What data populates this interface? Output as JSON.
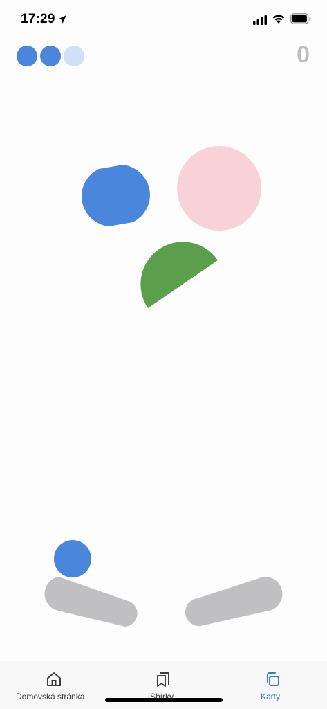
{
  "status_bar": {
    "time": "17:29",
    "icons": [
      "location-arrow-icon",
      "cellular-signal-icon",
      "wifi-icon",
      "battery-icon"
    ]
  },
  "game": {
    "lives_total": 3,
    "lives_remaining": 2,
    "score": "0",
    "colors": {
      "life_active": "#4a86db",
      "life_inactive": "#cfe0f7",
      "bumper_capsule": "#4a86db",
      "bumper_circle": "#f8d2d8",
      "bumper_half_disc": "#5b9f4c",
      "ball": "#4a86db",
      "flipper": "#c0c0c2",
      "score": "#bdbdbd"
    }
  },
  "tab_bar": {
    "tabs": [
      {
        "label": "Domovská stránka",
        "icon": "home-icon",
        "active": false
      },
      {
        "label": "Sbírky",
        "icon": "bookmarks-icon",
        "active": false
      },
      {
        "label": "Karty",
        "icon": "tabs-icon",
        "active": true
      }
    ],
    "active_color": "#3478c6",
    "inactive_color": "#3c3c3c"
  }
}
